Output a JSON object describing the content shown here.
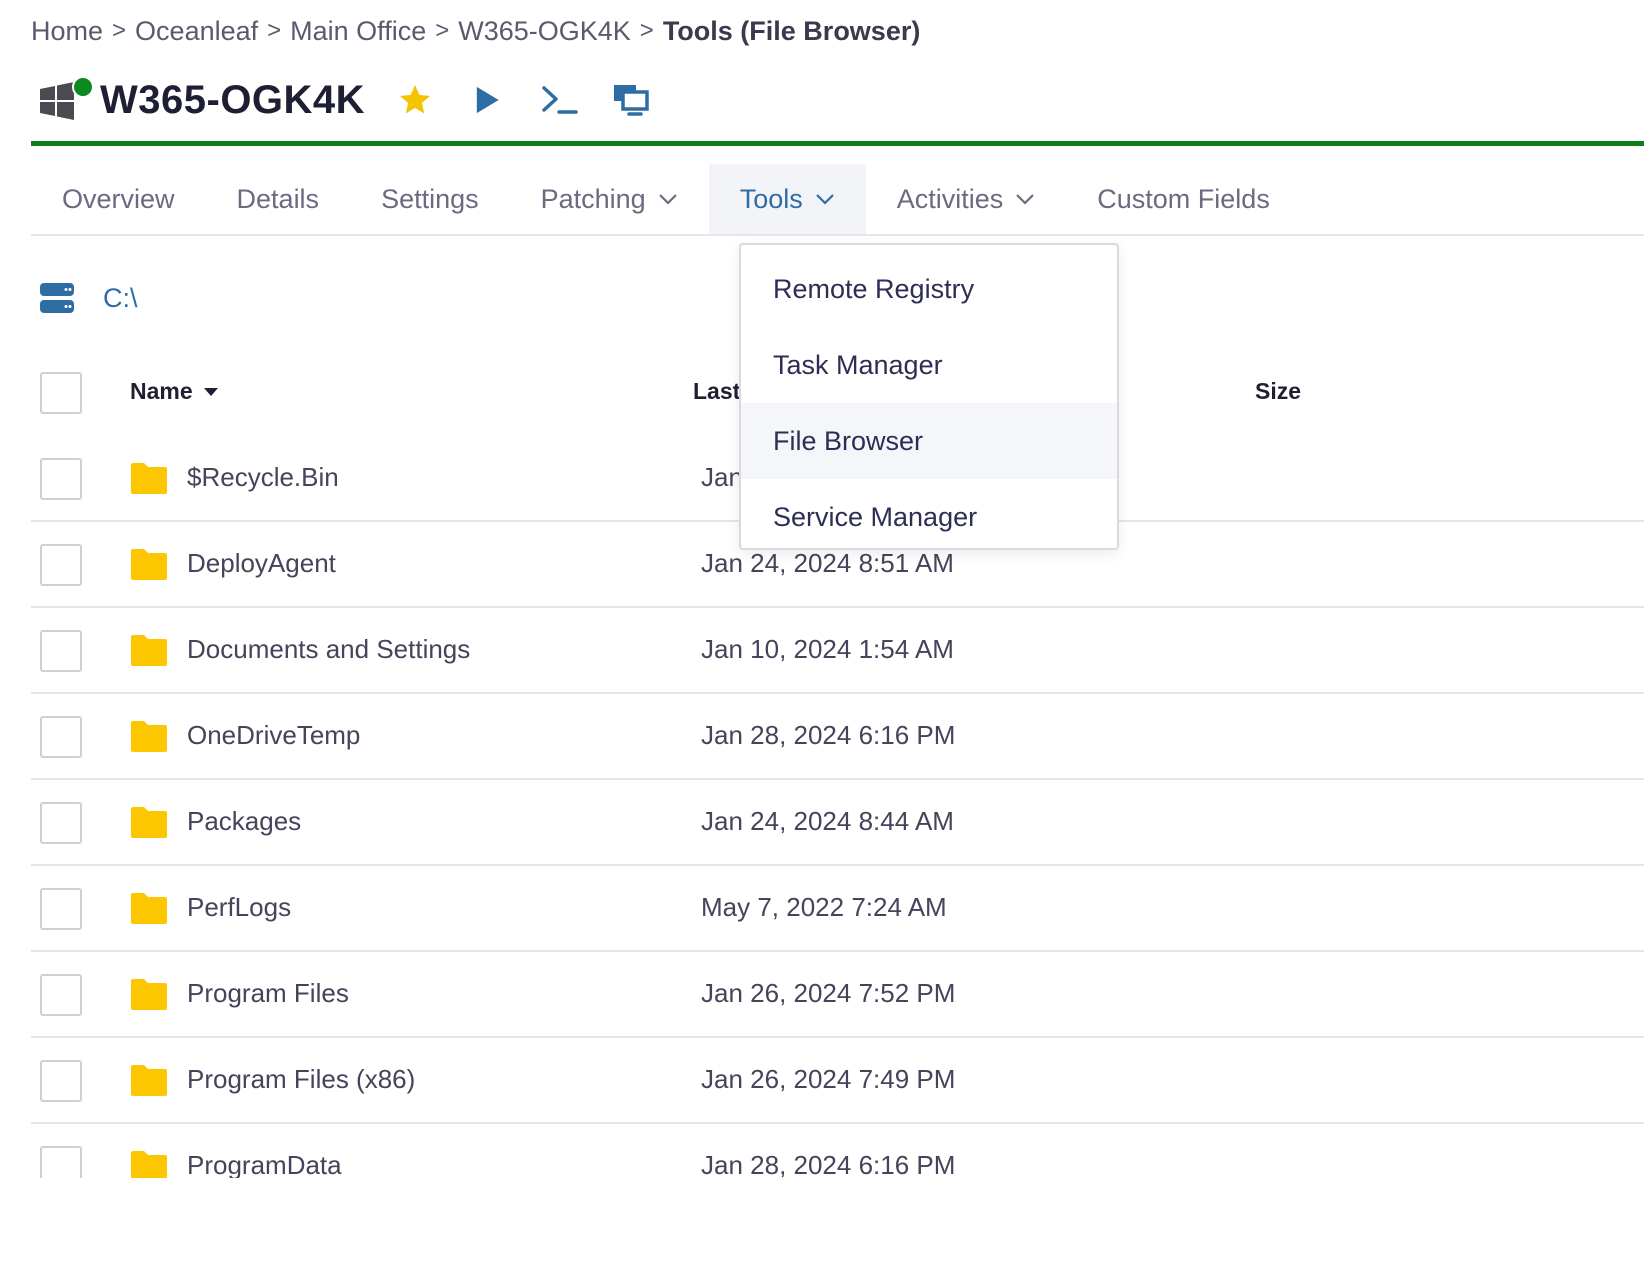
{
  "breadcrumb": {
    "items": [
      "Home",
      "Oceanleaf",
      "Main Office",
      "W365-OGK4K"
    ],
    "current": "Tools (File Browser)",
    "separator": ">"
  },
  "device": {
    "name": "W365-OGK4K",
    "status_color": "#0b8a1f",
    "os_icon": "windows-icon"
  },
  "header_actions": [
    {
      "icon": "star-icon",
      "color": "#f5c400"
    },
    {
      "icon": "play-icon",
      "color": "#2e6da4"
    },
    {
      "icon": "terminal-icon",
      "color": "#2e6da4"
    },
    {
      "icon": "remote-desktop-icon",
      "color": "#2e6da4"
    }
  ],
  "tabs": [
    {
      "label": "Overview"
    },
    {
      "label": "Details"
    },
    {
      "label": "Settings"
    },
    {
      "label": "Patching",
      "dropdown": true
    },
    {
      "label": "Tools",
      "dropdown": true,
      "active": true
    },
    {
      "label": "Activities",
      "dropdown": true
    },
    {
      "label": "Custom Fields"
    }
  ],
  "tools_menu": [
    "Remote Registry",
    "Task Manager",
    "File Browser",
    "Service Manager"
  ],
  "path": {
    "icon": "drive-icon",
    "value": "C:\\"
  },
  "table": {
    "columns": {
      "name": "Name",
      "modified": "Last",
      "size": "Size"
    },
    "sort_icon": "caret-down-icon",
    "rows": [
      {
        "name": "$Recycle.Bin",
        "modified": "Jan"
      },
      {
        "name": "DeployAgent",
        "modified": "Jan 24, 2024 8:51 AM"
      },
      {
        "name": "Documents and Settings",
        "modified": "Jan 10, 2024 1:54 AM"
      },
      {
        "name": "OneDriveTemp",
        "modified": "Jan 28, 2024 6:16 PM"
      },
      {
        "name": "Packages",
        "modified": "Jan 24, 2024 8:44 AM"
      },
      {
        "name": "PerfLogs",
        "modified": "May 7, 2022 7:24 AM"
      },
      {
        "name": "Program Files",
        "modified": "Jan 26, 2024 7:52 PM"
      },
      {
        "name": "Program Files (x86)",
        "modified": "Jan 26, 2024 7:49 PM"
      },
      {
        "name": "ProgramData",
        "modified": "Jan 28, 2024 6:16 PM"
      }
    ]
  },
  "colors": {
    "accent": "#2e6da4",
    "status_bar": "#0b7d1a",
    "folder": "#fcc700"
  }
}
